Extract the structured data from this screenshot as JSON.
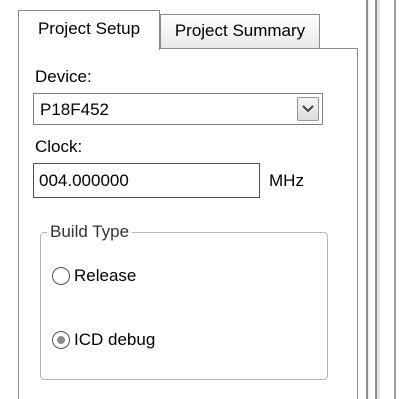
{
  "tabs": [
    {
      "label": "Project Setup",
      "active": true
    },
    {
      "label": "Project Summary",
      "active": false
    }
  ],
  "device": {
    "label": "Device:",
    "value": "P18F452"
  },
  "clock": {
    "label": "Clock:",
    "value": "004.000000",
    "units": "MHz"
  },
  "build_type": {
    "title": "Build Type",
    "options": [
      {
        "label": "Release",
        "selected": false
      },
      {
        "label": "ICD debug",
        "selected": true
      }
    ]
  }
}
